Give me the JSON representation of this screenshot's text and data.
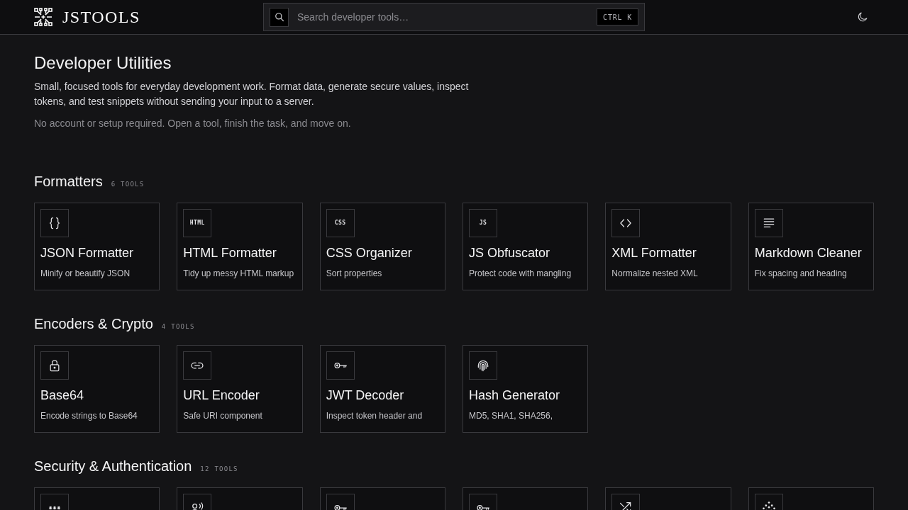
{
  "header": {
    "logo_text": "JSTOOLS",
    "search": {
      "placeholder": "Search developer tools…",
      "shortcut": "CTRL K"
    }
  },
  "intro": {
    "title": "Developer Utilities",
    "description": "Small, focused tools for everyday development work. Format data, generate secure values, inspect tokens, and test snippets without sending your input to a server.",
    "note": "No account or setup required. Open a tool, finish the task, and move on."
  },
  "sections": [
    {
      "title": "Formatters",
      "count": "6 TOOLS",
      "tools": [
        {
          "kind": "braces",
          "name": "JSON Formatter",
          "description": "Minify or beautify JSON"
        },
        {
          "kind": "text",
          "icon_text": "HTML",
          "name": "HTML Formatter",
          "description": "Tidy up messy HTML markup"
        },
        {
          "kind": "text",
          "icon_text": "CSS",
          "name": "CSS Organizer",
          "description": "Sort properties"
        },
        {
          "kind": "text",
          "icon_text": "JS",
          "name": "JS Obfuscator",
          "description": "Protect code with mangling"
        },
        {
          "kind": "chevrons",
          "name": "XML Formatter",
          "description": "Normalize nested XML"
        },
        {
          "kind": "lines",
          "name": "Markdown Cleaner",
          "description": "Fix spacing and heading"
        }
      ]
    },
    {
      "title": "Encoders & Crypto",
      "count": "4 TOOLS",
      "tools": [
        {
          "kind": "lock",
          "name": "Base64",
          "description": "Encode strings to Base64"
        },
        {
          "kind": "link",
          "name": "URL Encoder",
          "description": "Safe URI component"
        },
        {
          "kind": "key",
          "name": "JWT Decoder",
          "description": "Inspect token header and"
        },
        {
          "kind": "fingerprint",
          "name": "Hash Generator",
          "description": "MD5, SHA1, SHA256,"
        }
      ]
    },
    {
      "title": "Security & Authentication",
      "count": "12 TOOLS",
      "tools": [
        {
          "kind": "asterisks"
        },
        {
          "kind": "voice"
        },
        {
          "kind": "key"
        },
        {
          "kind": "key"
        },
        {
          "kind": "shuffle"
        },
        {
          "kind": "dots"
        }
      ]
    }
  ]
}
